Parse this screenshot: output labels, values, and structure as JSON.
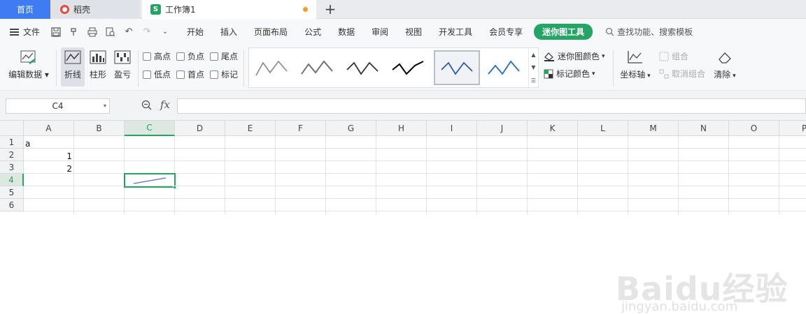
{
  "tabs": {
    "home": "首页",
    "docer": "稻壳",
    "workbook": "工作簿1",
    "add": "+"
  },
  "menubar": {
    "file": "文件",
    "items": [
      "开始",
      "插入",
      "页面布局",
      "公式",
      "数据",
      "审阅",
      "视图",
      "开发工具",
      "会员专享"
    ],
    "active": "迷你图工具",
    "search": "查找功能、搜索模板"
  },
  "ribbon": {
    "edit_data": "编辑数据",
    "line": "折线",
    "column": "柱形",
    "winloss": "盈亏",
    "checks": [
      "高点",
      "负点",
      "尾点",
      "低点",
      "首点",
      "标记"
    ],
    "sparkline_color": "迷你图颜色",
    "marker_color": "标记颜色",
    "axis": "坐标轴",
    "group": "组合",
    "ungroup": "取消组合",
    "clear": "清除"
  },
  "formula": {
    "cell_ref": "C4",
    "fx": "fx",
    "value": ""
  },
  "grid": {
    "columns": [
      "A",
      "B",
      "C",
      "D",
      "E",
      "F",
      "G",
      "H",
      "I",
      "J",
      "K",
      "L",
      "M",
      "N",
      "O",
      "P"
    ],
    "rows": [
      "1",
      "2",
      "3",
      "4",
      "5",
      "6"
    ],
    "cells": {
      "A1": "a",
      "A2": "1",
      "A3": "2"
    },
    "active_column": "C",
    "active_row": "4"
  },
  "watermark": {
    "brand": "Baidu经验",
    "url": "jingyan.baidu.com"
  },
  "colors": {
    "accent": "#25a465",
    "home_tab": "#3d7cf2",
    "sparkline": "#5a6bbf"
  }
}
